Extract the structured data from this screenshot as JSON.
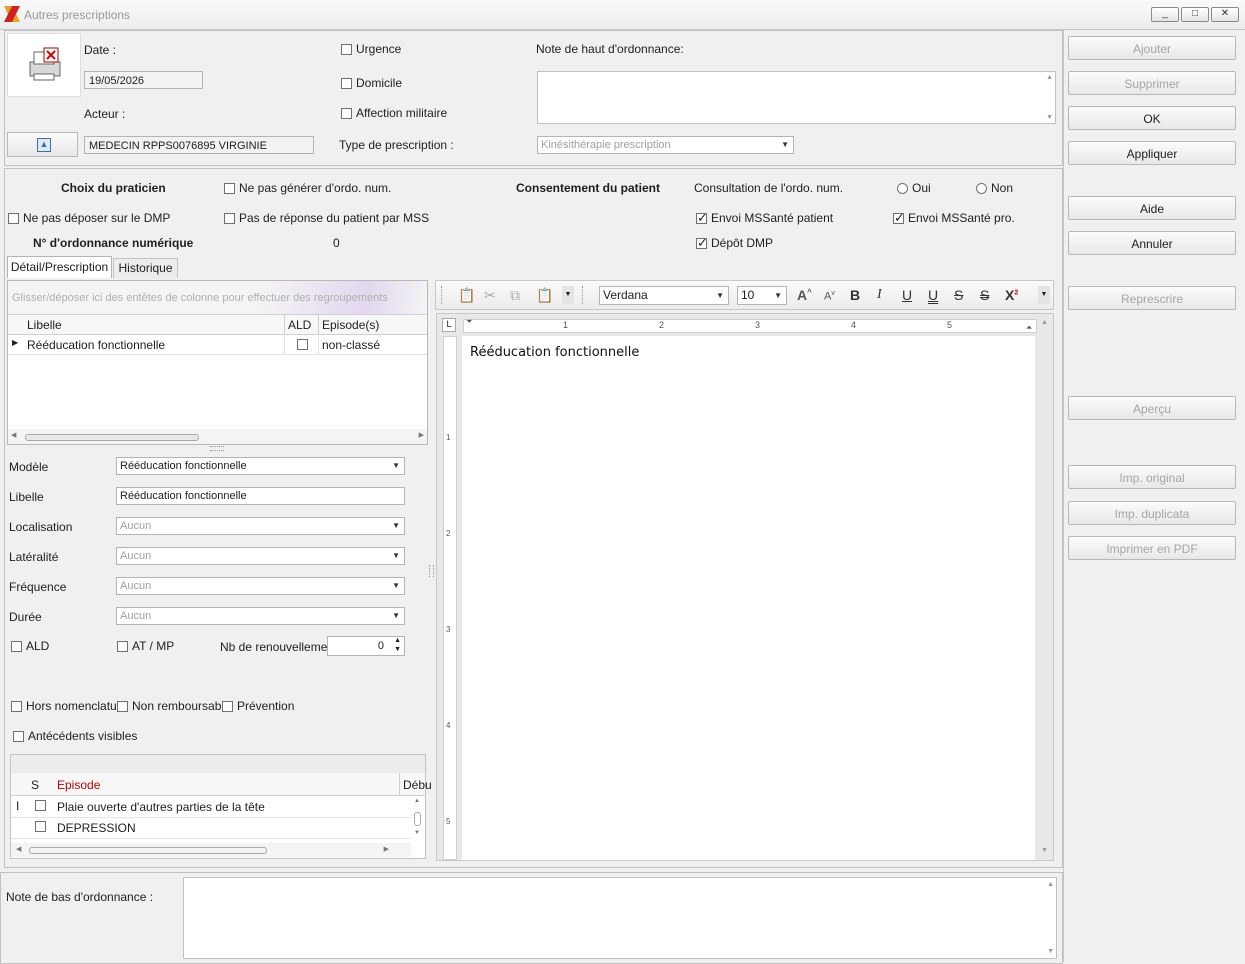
{
  "window": {
    "title": "Autres prescriptions",
    "controls": [
      "_",
      "□",
      "✕"
    ]
  },
  "header": {
    "date_label": "Date :",
    "date_value": "19/05/2026",
    "acteur_label": "Acteur :",
    "acteur_value": "MEDECIN RPPS0076895 VIRGINIE",
    "urgence": "Urgence",
    "domicile": "Domicile",
    "affection_militaire": "Affection militaire",
    "type_label": "Type de prescription :",
    "type_value": "Kinésithérapie prescription",
    "note_haut_label": "Note de haut d'ordonnance:"
  },
  "options": {
    "choix_praticien": "Choix du praticien",
    "ne_pas_generer": "Ne pas générer d'ordo. num.",
    "consentement": "Consentement du patient",
    "consultation": "Consultation de l'ordo. num.",
    "oui": "Oui",
    "non": "Non",
    "ne_pas_deposer": "Ne pas déposer sur le DMP",
    "pas_de_reponse": "Pas de réponse du patient par MSS",
    "envoi_patient": "Envoi MSSanté patient",
    "envoi_pro": "Envoi MSSanté pro.",
    "numero_label": "N° d'ordonnance numérique",
    "numero_value": "0",
    "depot_dmp": "Dépôt DMP"
  },
  "tabs": [
    "Détail/Prescription",
    "Historique"
  ],
  "grid": {
    "group_hint": "Glisser/déposer ici des entêtes de colonne pour effectuer des regroupements",
    "columns": [
      "Libelle",
      "ALD",
      "Episode(s)"
    ],
    "rows": [
      {
        "libelle": "Rééducation fonctionnelle",
        "episode": "non-classé"
      }
    ]
  },
  "form": {
    "modele_label": "Modèle",
    "modele_value": "Rééducation fonctionnelle",
    "libelle_label": "Libelle",
    "libelle_value": "Rééducation fonctionnelle",
    "localisation_label": "Localisation",
    "localisation_value": "Aucun",
    "lateralite_label": "Latéralité",
    "lateralite_value": "Aucun",
    "frequence_label": "Fréquence",
    "frequence_value": "Aucun",
    "duree_label": "Durée",
    "duree_value": "Aucun",
    "ald": "ALD",
    "at_mp": "AT / MP",
    "nb_label": "Nb de renouvellemen",
    "nb_value": "0",
    "hors_nomenclature": "Hors nomenclatu",
    "non_remboursable": "Non remboursabl",
    "prevention": "Prévention",
    "antecedents": "Antécédents visibles"
  },
  "episodes": {
    "columns": [
      "S",
      "Episode",
      "Débu"
    ],
    "rows": [
      "Plaie ouverte d'autres parties de la tête",
      "DEPRESSION"
    ]
  },
  "editor": {
    "font": "Verdana",
    "size": "10",
    "content": "Rééducation fonctionnelle",
    "ruler": [
      "1",
      "2",
      "3",
      "4",
      "5"
    ],
    "vruler": [
      "1",
      "2",
      "3",
      "4",
      "5"
    ]
  },
  "footer": {
    "note_bas_label": "Note de bas d'ordonnance :"
  },
  "buttons": {
    "ajouter": "Ajouter",
    "supprimer": "Supprimer",
    "ok": "OK",
    "appliquer": "Appliquer",
    "aide": "Aide",
    "annuler": "Annuler",
    "represcrire": "Represcrire",
    "apercu": "Aperçu",
    "imp_original": "Imp. original",
    "imp_duplicata": "Imp. duplicata",
    "imprimer_pdf": "Imprimer en PDF"
  },
  "colors": {
    "episode_header": "#c00000",
    "accent": "#3a6fb0"
  }
}
